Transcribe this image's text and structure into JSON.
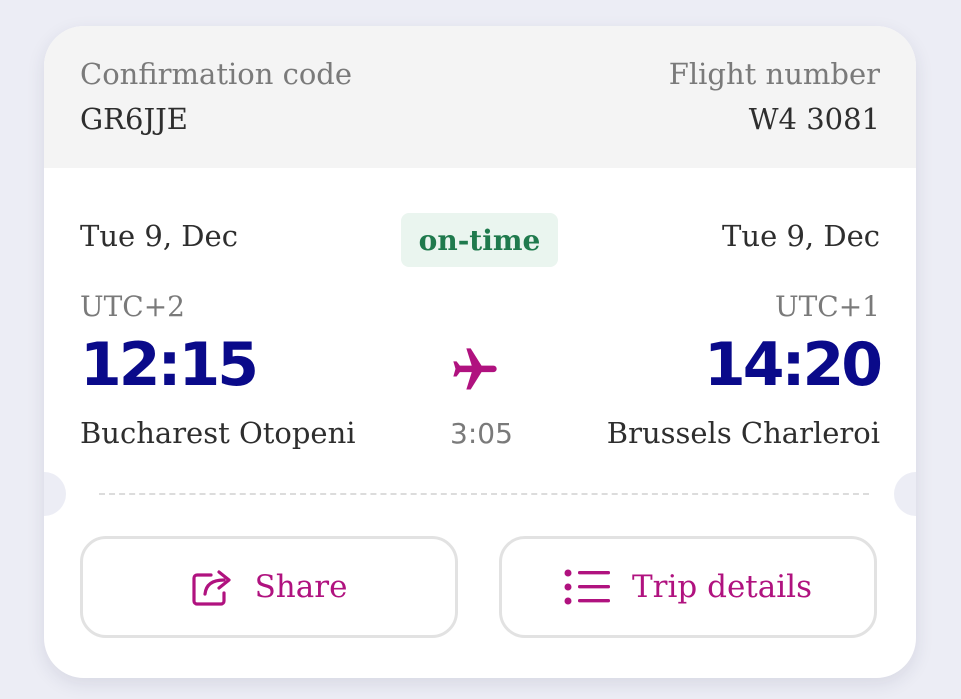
{
  "booking": {
    "confirmation_label": "Confirmation code",
    "confirmation_code": "GR6JJE",
    "flight_label": "Flight number",
    "flight_number": "W4 3081"
  },
  "status": "on-time",
  "departure": {
    "date": "Tue 9, Dec",
    "timezone": "UTC+2",
    "time": "12:15",
    "airport": "Bucharest Otopeni"
  },
  "arrival": {
    "date": "Tue 9, Dec",
    "timezone": "UTC+1",
    "time": "14:20",
    "airport": "Brussels Charleroi"
  },
  "duration": "3:05",
  "actions": {
    "share_label": "Share",
    "share_icon": "share-icon",
    "details_label": "Trip details",
    "details_icon": "list-icon"
  },
  "colors": {
    "accent": "#b0127f",
    "time": "#0a0a8a",
    "status_text": "#1f7a4d",
    "status_bg": "#eaf5ef"
  }
}
